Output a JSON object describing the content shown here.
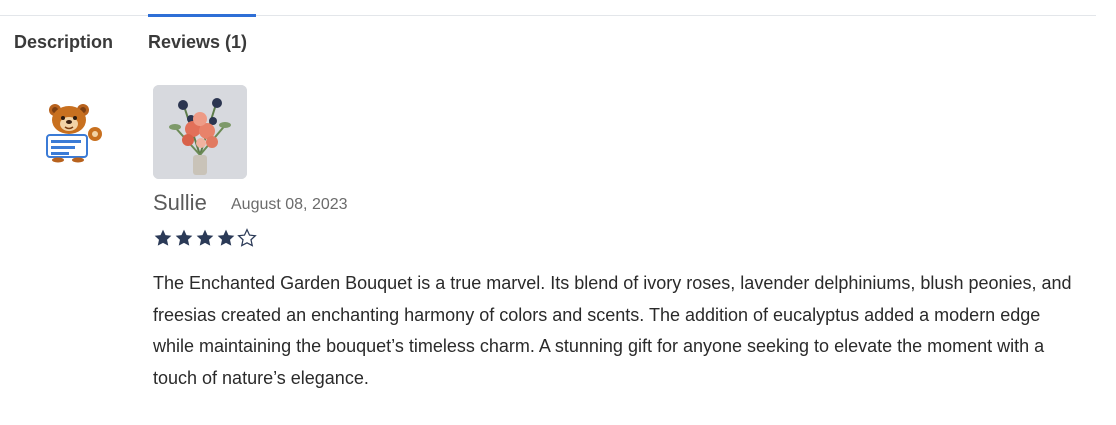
{
  "tabs": [
    {
      "label": "Description",
      "active": false
    },
    {
      "label": "Reviews (1)",
      "active": true
    }
  ],
  "review": {
    "reviewer": "Sullie",
    "date": "August 08, 2023",
    "rating": 4,
    "max_rating": 5,
    "text": "The Enchanted Garden Bouquet is a true marvel. Its blend of ivory roses, lavender delphiniums, blush peonies, and freesias created an enchanting harmony of colors and scents. The addition of eucalyptus added a modern edge while maintaining the bouquet’s timeless charm. A stunning gift for anyone seeking to elevate the moment with a touch of nature’s elegance."
  },
  "colors": {
    "tab_active_indicator": "#2f6fd6",
    "star_filled": "#2b3a57",
    "star_empty_outline": "#2b3a57"
  },
  "icons": {
    "avatar": "bear-mascot-avatar",
    "photo": "bouquet-photo"
  }
}
